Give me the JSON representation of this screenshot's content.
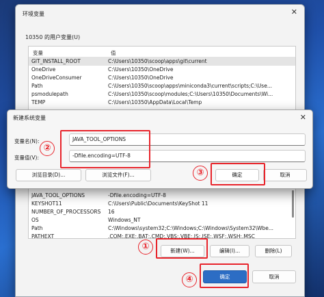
{
  "main_window": {
    "title": "环境变量",
    "close_glyph": "✕",
    "user_section_label": "10350 的用户变量(U)",
    "columns": [
      "变量",
      "值"
    ],
    "user_vars": [
      {
        "name": "GIT_INSTALL_ROOT",
        "value": "C:\\Users\\10350\\scoop\\apps\\git\\current"
      },
      {
        "name": "OneDrive",
        "value": "C:\\Users\\10350\\OneDrive"
      },
      {
        "name": "OneDriveConsumer",
        "value": "C:\\Users\\10350\\OneDrive"
      },
      {
        "name": "Path",
        "value": "C:\\Users\\10350\\scoop\\apps\\miniconda3\\current\\scripts;C:\\Use..."
      },
      {
        "name": "psmodulepath",
        "value": "C:\\Users\\10350\\scoop\\modules;C:\\Users\\10350\\Documents\\Wi..."
      },
      {
        "name": "TEMP",
        "value": "C:\\Users\\10350\\AppData\\Local\\Temp"
      }
    ],
    "system_vars": [
      {
        "name": "JAVA_TOOL_OPTIONS",
        "value": "-Dfile.encoding=UTF-8"
      },
      {
        "name": "KEYSHOT11",
        "value": "C:\\Users\\Public\\Documents\\KeyShot 11"
      },
      {
        "name": "NUMBER_OF_PROCESSORS",
        "value": "16"
      },
      {
        "name": "OS",
        "value": "Windows_NT"
      },
      {
        "name": "Path",
        "value": "C:\\Windows\\system32;C:\\Windows;C:\\Windows\\System32\\Wbe..."
      },
      {
        "name": "PATHEXT",
        "value": ".COM;.EXE;.BAT;.CMD;.VBS;.VBE;.JS;.JSE;.WSF;.WSH;.MSC"
      }
    ],
    "sys_buttons": {
      "new": "新建(W)...",
      "edit": "编辑(I)...",
      "delete": "删除(L)"
    },
    "ok": "确定",
    "cancel": "取消"
  },
  "dialog": {
    "title": "新建系统变量",
    "close_glyph": "✕",
    "name_label": "变量名(N):",
    "value_label": "变量值(V):",
    "name_value": "JAVA_TOOL_OPTIONS",
    "value_value": "-Dfile.encoding=UTF-8",
    "browse_dir": "浏览目录(D)...",
    "browse_file": "浏览文件(F)...",
    "ok": "确定",
    "cancel": "取消"
  },
  "markers": {
    "m1": "①",
    "m2": "②",
    "m3": "③",
    "m4": "④"
  },
  "colors": {
    "highlight": "#e8232a",
    "accent": "#2c6dc4"
  }
}
